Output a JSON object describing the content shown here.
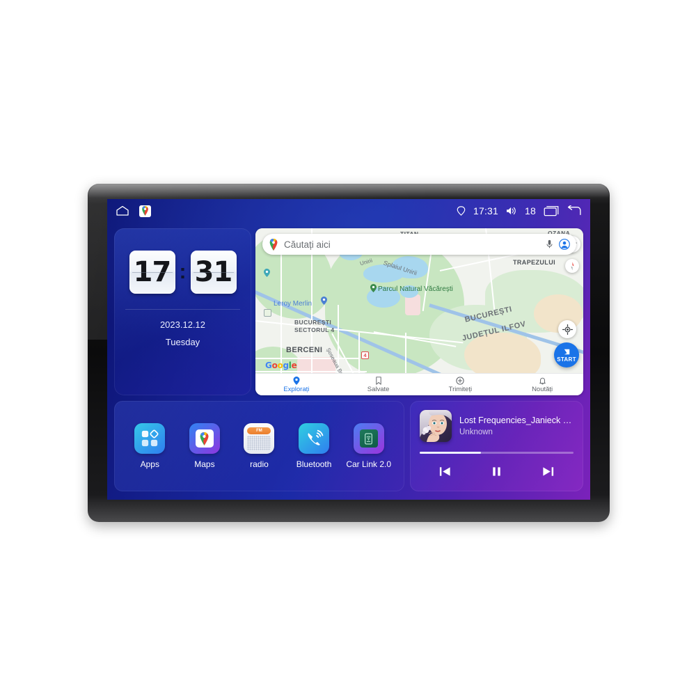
{
  "status_bar": {
    "home_icon": "home-icon",
    "maps_shortcut_icon": "google-maps-icon",
    "gps_icon": "location-pin-icon",
    "time": "17:31",
    "volume_icon": "volume-icon",
    "volume_level": "18",
    "recents_icon": "recents-icon",
    "back_icon": "back-arrow-icon"
  },
  "clock_widget": {
    "hours": "17",
    "separator": ":",
    "minutes": "31",
    "date": "2023.12.12",
    "day": "Tuesday"
  },
  "maps_widget": {
    "search": {
      "placeholder": "Căutați aici",
      "pin_icon": "google-maps-pin-icon",
      "mic_icon": "microphone-icon",
      "account_icon": "account-avatar-icon"
    },
    "controls": {
      "layers_icon": "layers-icon",
      "compass_icon": "compass-icon",
      "locate_icon": "my-location-icon",
      "start_label": "START",
      "start_icon": "navigation-arrow-icon"
    },
    "attribution": "Google",
    "labels": [
      {
        "text": "TITAN",
        "kind": "city"
      },
      {
        "text": "OZANA",
        "kind": "city"
      },
      {
        "text": "TRAPEZULUI",
        "kind": "area"
      },
      {
        "text": "Splaiul Unirii",
        "kind": "road"
      },
      {
        "text": "Unirii",
        "kind": "road"
      },
      {
        "text": "Parcul Natural Văcărești",
        "kind": "park"
      },
      {
        "text": "Leroy Merlin",
        "kind": "poi"
      },
      {
        "text": "BUCUREȘTI",
        "kind": "city"
      },
      {
        "text": "SECTORUL 4",
        "kind": "city"
      },
      {
        "text": "BERCENI",
        "kind": "area"
      },
      {
        "text": "Șoseaua Be",
        "kind": "road"
      },
      {
        "text": "BUCUREȘTI",
        "kind": "boundary"
      },
      {
        "text": "JUDEȚUL ILFOV",
        "kind": "boundary"
      },
      {
        "text": "4",
        "kind": "highway-shield"
      }
    ],
    "bottom_nav": [
      {
        "label": "Explorați",
        "icon": "explore-pin-icon",
        "active": true
      },
      {
        "label": "Salvate",
        "icon": "bookmark-icon",
        "active": false
      },
      {
        "label": "Trimiteți",
        "icon": "contribute-plus-icon",
        "active": false
      },
      {
        "label": "Noutăți",
        "icon": "bell-icon",
        "active": false
      }
    ]
  },
  "app_dock": {
    "items": [
      {
        "label": "Apps",
        "icon": "apps-grid-icon"
      },
      {
        "label": "Maps",
        "icon": "google-maps-icon"
      },
      {
        "label": "radio",
        "icon": "fm-radio-icon",
        "badge": "FM"
      },
      {
        "label": "Bluetooth",
        "icon": "bluetooth-phone-icon"
      },
      {
        "label": "Car Link 2.0",
        "icon": "car-link-icon"
      }
    ]
  },
  "music_widget": {
    "album_art": "album-art-woman-portrait",
    "title": "Lost Frequencies_Janieck Devy-...",
    "artist": "Unknown",
    "progress_percent": 40,
    "controls": [
      {
        "name": "previous-track-button",
        "icon": "skip-previous-icon"
      },
      {
        "name": "play-pause-button",
        "icon": "pause-icon"
      },
      {
        "name": "next-track-button",
        "icon": "skip-next-icon"
      }
    ]
  },
  "colors": {
    "wallpaper_blue": "#15208f",
    "wallpaper_purple": "#7b22ba",
    "maps_accent": "#1a73e8",
    "bezel": "#0b0b0c"
  }
}
